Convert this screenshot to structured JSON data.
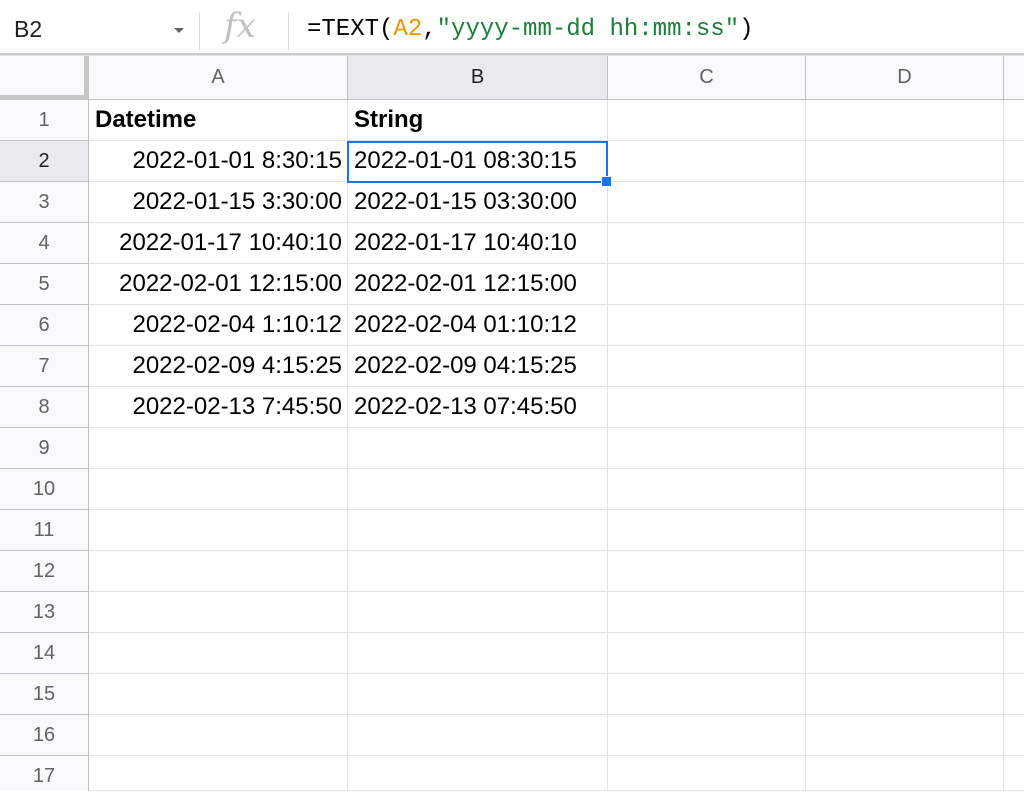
{
  "name_box": "B2",
  "fx_label": "fx",
  "formula": {
    "prefix": "=TEXT(",
    "ref": "A2",
    "comma": ",",
    "string": "\"yyyy-mm-dd hh:mm:ss\"",
    "suffix": ")"
  },
  "selected_cell": "B2",
  "columns": [
    "A",
    "B",
    "C",
    "D"
  ],
  "rows": [
    "1",
    "2",
    "3",
    "4",
    "5",
    "6",
    "7",
    "8",
    "9",
    "10",
    "11",
    "12",
    "13",
    "14",
    "15",
    "16",
    "17"
  ],
  "cells": {
    "header": {
      "A": "Datetime",
      "B": "String"
    },
    "data": [
      {
        "A": "2022-01-01 8:30:15",
        "B": "2022-01-01 08:30:15"
      },
      {
        "A": "2022-01-15 3:30:00",
        "B": "2022-01-15 03:30:00"
      },
      {
        "A": "2022-01-17 10:40:10",
        "B": "2022-01-17 10:40:10"
      },
      {
        "A": "2022-02-01 12:15:00",
        "B": "2022-02-01 12:15:00"
      },
      {
        "A": "2022-02-04 1:10:12",
        "B": "2022-02-04 01:10:12"
      },
      {
        "A": "2022-02-09 4:15:25",
        "B": "2022-02-09 04:15:25"
      },
      {
        "A": "2022-02-13 7:45:50",
        "B": "2022-02-13 07:45:50"
      }
    ]
  },
  "colors": {
    "selection": "#1a73e8",
    "formula_ref": "#f09300",
    "formula_string": "#188038",
    "header_bg": "#f8f9fa",
    "header_selected_bg": "#e8eaed"
  }
}
